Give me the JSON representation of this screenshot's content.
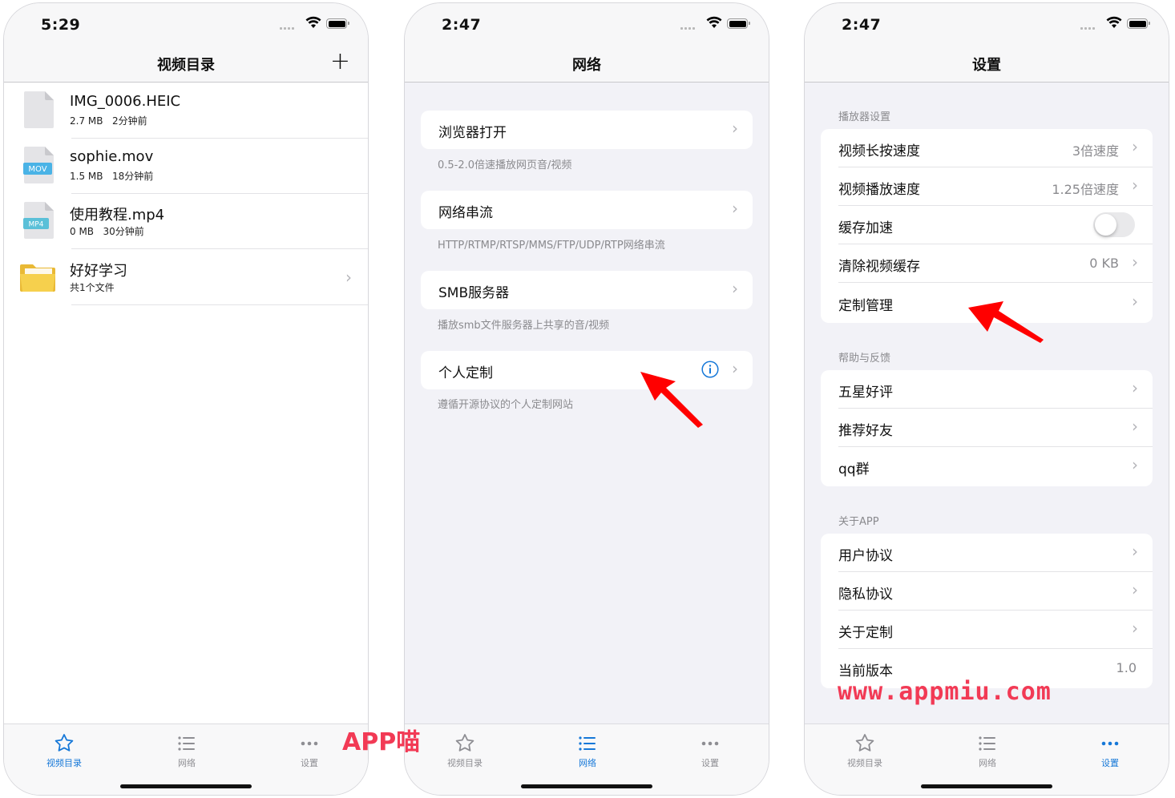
{
  "phone1": {
    "time": "5:29",
    "title": "视频目录",
    "add_symbol": "+",
    "files": [
      {
        "name": "IMG_0006.HEIC",
        "size": "2.7 MB",
        "ago": "2分钟前",
        "icon": "blank-file-icon"
      },
      {
        "name": "sophie.mov",
        "size": "1.5 MB",
        "ago": "18分钟前",
        "icon": "mov-file-icon",
        "badge": "MOV",
        "badge_color": "#4ab3e6"
      },
      {
        "name": "使用教程.mp4",
        "size": "0 MB",
        "ago": "30分钟前",
        "icon": "mp4-file-icon",
        "badge": "MP4",
        "badge_color": "#5bc0d8"
      }
    ],
    "folder": {
      "name": "好好学习",
      "meta": "共1个文件",
      "icon": "folder-icon",
      "color": "#f6d04d"
    }
  },
  "phone2": {
    "time": "2:47",
    "title": "网络",
    "items": [
      {
        "label": "浏览器打开",
        "footer": "0.5-2.0倍速播放网页音/视频"
      },
      {
        "label": "网络串流",
        "footer": "HTTP/RTMP/RTSP/MMS/FTP/UDP/RTP网络串流"
      },
      {
        "label": "SMB服务器",
        "footer": "播放smb文件服务器上共享的音/视频"
      },
      {
        "label": "个人定制",
        "footer": "遵循开源协议的个人定制网站"
      }
    ]
  },
  "phone3": {
    "time": "2:47",
    "title": "设置",
    "sections": [
      {
        "header": "播放器设置",
        "rows": [
          {
            "label": "视频长按速度",
            "value": "3倍速度"
          },
          {
            "label": "视频播放速度",
            "value": "1.25倍速度"
          },
          {
            "label": "缓存加速",
            "toggle": false
          },
          {
            "label": "清除视频缓存",
            "value": "0 KB"
          },
          {
            "label": "定制管理",
            "value": ""
          }
        ]
      },
      {
        "header": "帮助与反馈",
        "rows": [
          {
            "label": "五星好评"
          },
          {
            "label": "推荐好友"
          },
          {
            "label": "qq群"
          }
        ]
      },
      {
        "header": "关于APP",
        "rows": [
          {
            "label": "用户协议"
          },
          {
            "label": "隐私协议"
          },
          {
            "label": "关于定制"
          },
          {
            "label": "当前版本",
            "value": "1.0"
          }
        ]
      }
    ]
  },
  "tabbar": {
    "tabs": [
      {
        "label": "视频目录",
        "icon": "star-icon"
      },
      {
        "label": "网络",
        "icon": "list-icon"
      },
      {
        "label": "设置",
        "icon": "more-dots-icon"
      }
    ],
    "active_color": "#1678d8",
    "inactive_color": "#8e8e93"
  },
  "watermarks": {
    "left": "APP喵",
    "right": "www.appmiu.com",
    "color": "#f23a55"
  },
  "annotation_color": "#f00"
}
